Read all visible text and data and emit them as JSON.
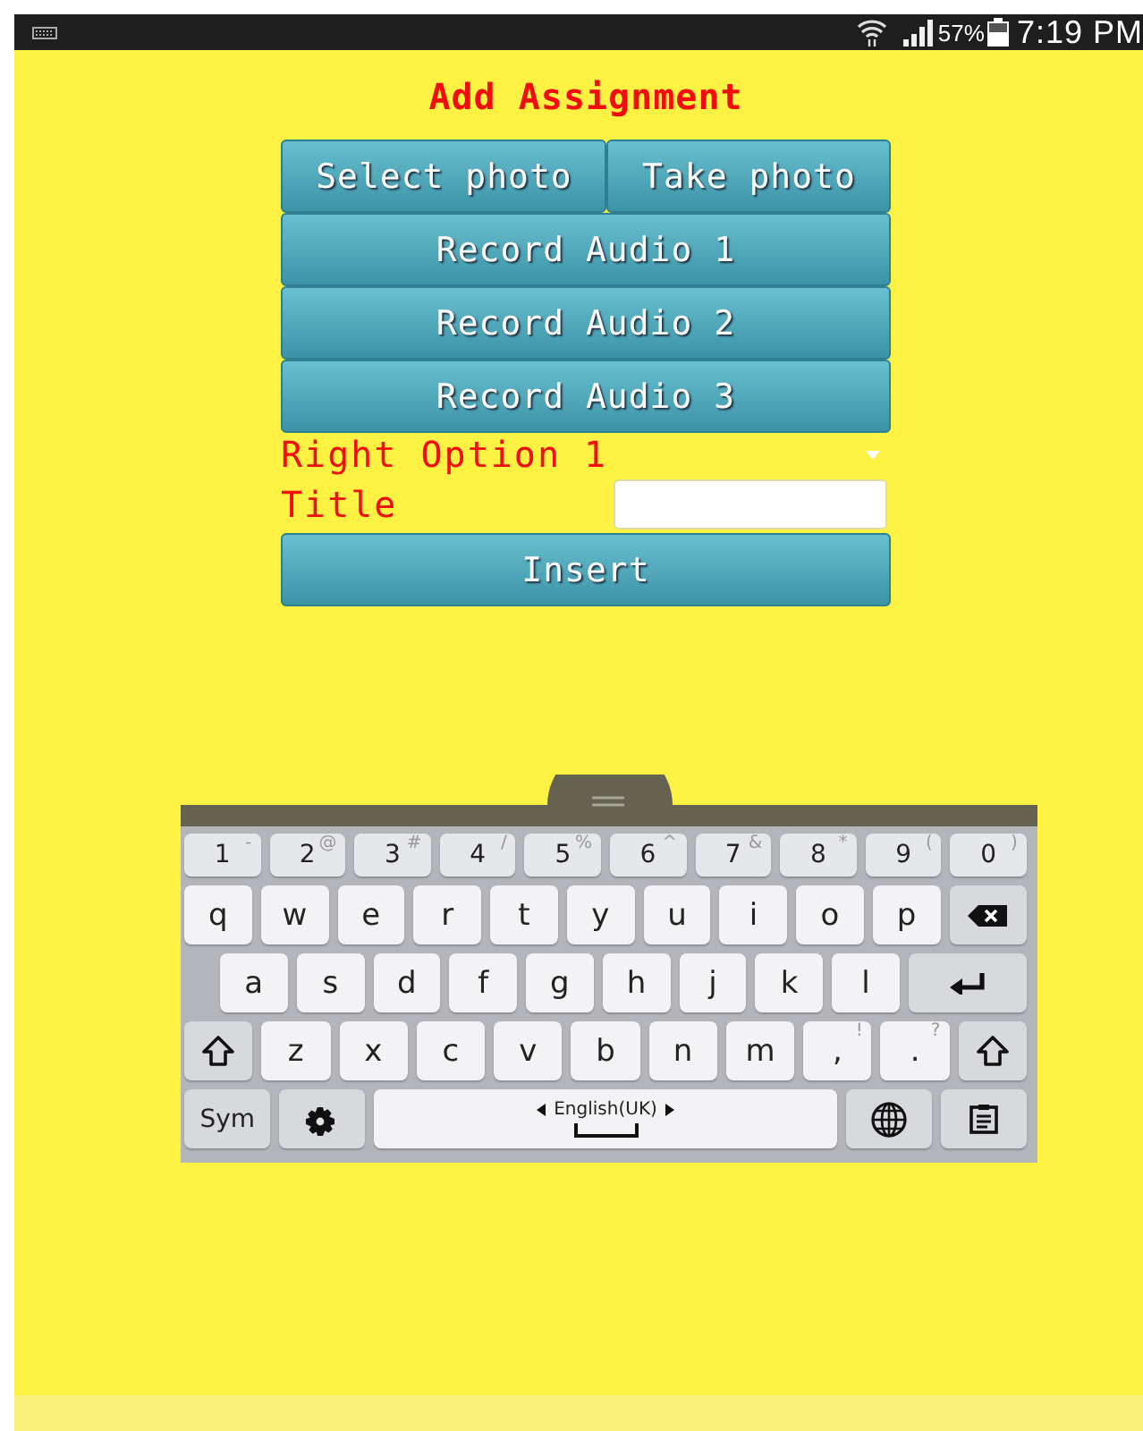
{
  "status_bar": {
    "battery": "57%",
    "time": "7:19 PM"
  },
  "screen": {
    "title": "Add Assignment",
    "photo_buttons": [
      "Select photo",
      "Take photo"
    ],
    "audio_buttons": [
      "Record Audio 1",
      "Record Audio 2",
      "Record Audio 3"
    ],
    "spinner": {
      "value": "Right Option 1"
    },
    "title_field": {
      "label": "Title"
    },
    "insert_button": "Insert"
  },
  "keyboard": {
    "rows": [
      {
        "keys": [
          {
            "kind": "num",
            "label": "1",
            "hint": "-"
          },
          {
            "kind": "num",
            "label": "2",
            "hint": "@"
          },
          {
            "kind": "num",
            "label": "3",
            "hint": "#"
          },
          {
            "kind": "num",
            "label": "4",
            "hint": "/"
          },
          {
            "kind": "num",
            "label": "5",
            "hint": "%"
          },
          {
            "kind": "num",
            "label": "6",
            "hint": "^"
          },
          {
            "kind": "num",
            "label": "7",
            "hint": "&"
          },
          {
            "kind": "num",
            "label": "8",
            "hint": "*"
          },
          {
            "kind": "num",
            "label": "9",
            "hint": "("
          },
          {
            "kind": "num",
            "label": "0",
            "hint": ")"
          }
        ]
      },
      {
        "keys": [
          {
            "kind": "char",
            "label": "q"
          },
          {
            "kind": "char",
            "label": "w"
          },
          {
            "kind": "char",
            "label": "e"
          },
          {
            "kind": "char",
            "label": "r"
          },
          {
            "kind": "char",
            "label": "t"
          },
          {
            "kind": "char",
            "label": "y"
          },
          {
            "kind": "char",
            "label": "u"
          },
          {
            "kind": "char",
            "label": "i"
          },
          {
            "kind": "char",
            "label": "o"
          },
          {
            "kind": "char",
            "label": "p"
          },
          {
            "kind": "backspace"
          }
        ]
      },
      {
        "keys": [
          {
            "kind": "char",
            "label": "a"
          },
          {
            "kind": "char",
            "label": "s"
          },
          {
            "kind": "char",
            "label": "d"
          },
          {
            "kind": "char",
            "label": "f"
          },
          {
            "kind": "char",
            "label": "g"
          },
          {
            "kind": "char",
            "label": "h"
          },
          {
            "kind": "char",
            "label": "j"
          },
          {
            "kind": "char",
            "label": "k"
          },
          {
            "kind": "char",
            "label": "l"
          },
          {
            "kind": "enter"
          }
        ]
      },
      {
        "keys": [
          {
            "kind": "shift"
          },
          {
            "kind": "char",
            "label": "z"
          },
          {
            "kind": "char",
            "label": "x"
          },
          {
            "kind": "char",
            "label": "c"
          },
          {
            "kind": "char",
            "label": "v"
          },
          {
            "kind": "char",
            "label": "b"
          },
          {
            "kind": "char",
            "label": "n"
          },
          {
            "kind": "char",
            "label": "m"
          },
          {
            "kind": "char",
            "label": ",",
            "hint": "!"
          },
          {
            "kind": "char",
            "label": ".",
            "hint": "?"
          },
          {
            "kind": "shift"
          }
        ]
      },
      {
        "keys": [
          {
            "kind": "sym",
            "label": "Sym"
          },
          {
            "kind": "settings"
          },
          {
            "kind": "space",
            "label": "English(UK)"
          },
          {
            "kind": "globe"
          },
          {
            "kind": "clipboard"
          }
        ]
      }
    ]
  }
}
